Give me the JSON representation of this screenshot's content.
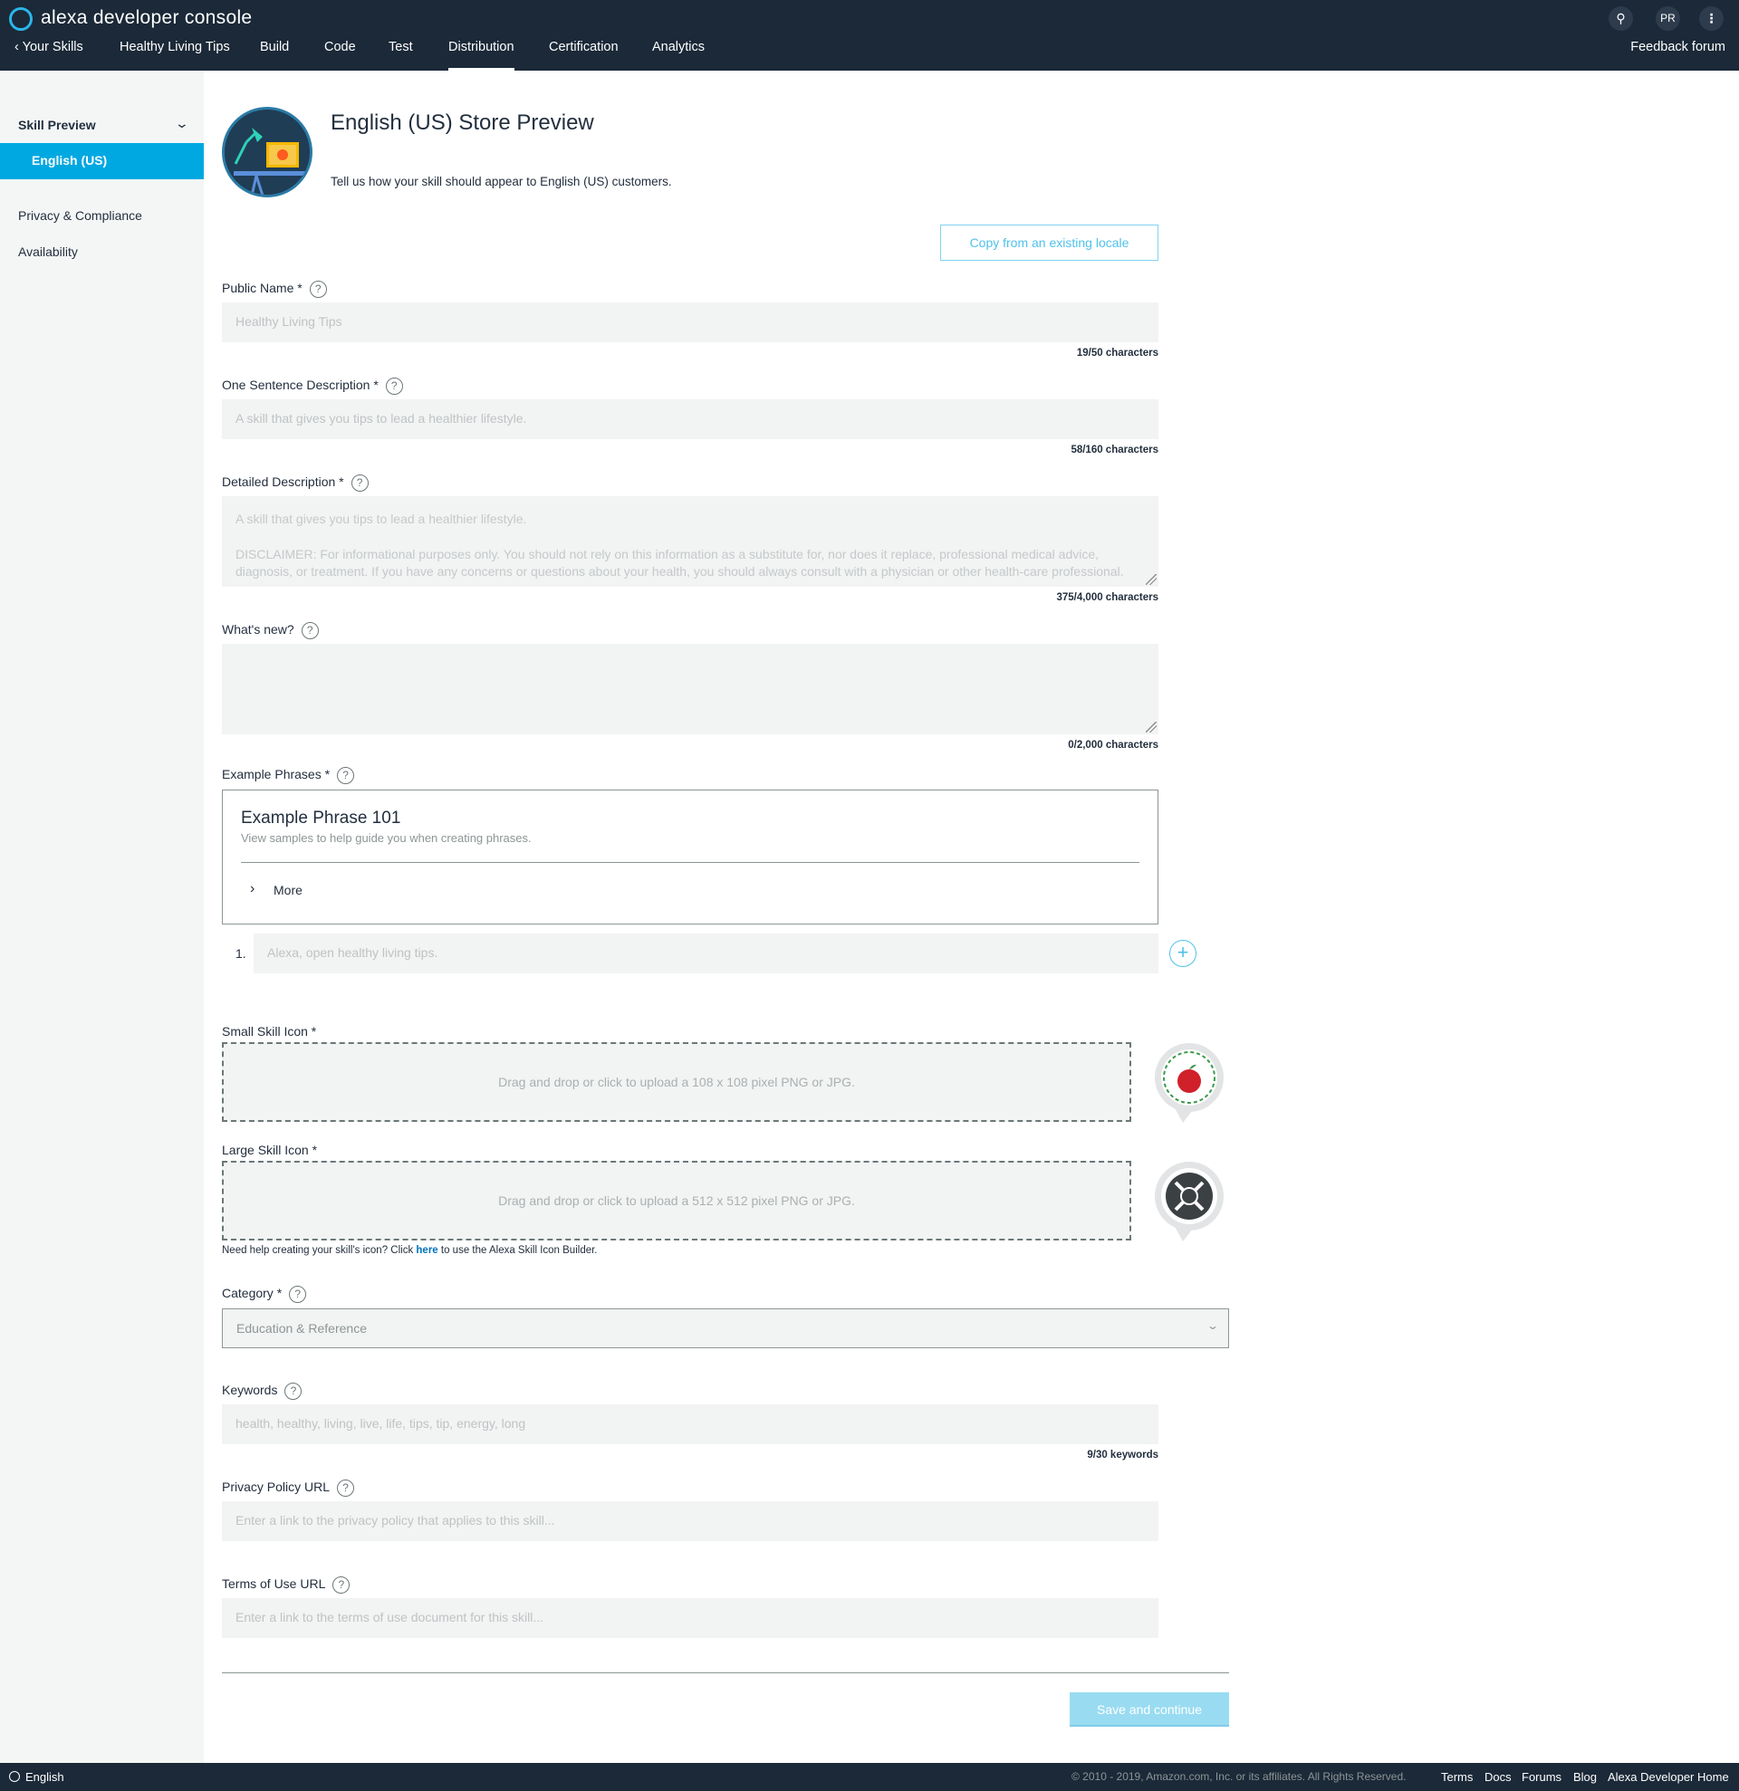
{
  "app": {
    "brand": "alexa developer console",
    "avatar_initials": "PR"
  },
  "nav": {
    "back_label": "Your Skills",
    "skill_name": "Healthy Living Tips",
    "tabs": [
      "Build",
      "Code",
      "Test",
      "Distribution",
      "Certification",
      "Analytics"
    ],
    "active_tab": "Distribution",
    "feedback": "Feedback forum"
  },
  "sidebar": {
    "group": "Skill Preview",
    "active_item": "English (US)",
    "items": [
      "Privacy & Compliance",
      "Availability"
    ]
  },
  "header": {
    "title": "English (US) Store Preview",
    "subtitle": "Tell us how your skill should appear to English (US) customers.",
    "copy_button": "Copy from an existing locale"
  },
  "fields": {
    "public_name": {
      "label": "Public Name *",
      "value": "Healthy Living Tips",
      "counter": "19/50 characters"
    },
    "one_sentence": {
      "label": "One Sentence Description *",
      "value": "A skill that gives you tips to lead a healthier lifestyle.",
      "counter": "58/160 characters"
    },
    "detailed": {
      "label": "Detailed Description *",
      "line1": "A skill that gives you tips to lead a healthier lifestyle.",
      "line2": "DISCLAIMER: For informational purposes only. You should not rely on this information as a substitute for, nor does it replace, professional medical advice,",
      "line3": "diagnosis, or treatment. If you have any concerns or questions about your health, you should always consult with a physician or other health-care professional.",
      "counter": "375/4,000 characters"
    },
    "whats_new": {
      "label": "What's new?",
      "counter": "0/2,000 characters"
    },
    "example_phrases": {
      "label": "Example Phrases *",
      "box_title": "Example Phrase 101",
      "box_sub": "View samples to help guide you when creating phrases.",
      "more": "More",
      "num": "1.",
      "phrase": "Alexa, open healthy living tips."
    },
    "small_icon": {
      "label": "Small Skill Icon *",
      "drop": "Drag and drop or click to upload a 108 x 108 pixel PNG or JPG."
    },
    "large_icon": {
      "label": "Large Skill Icon *",
      "drop": "Drag and drop or click to upload a 512 x 512 pixel PNG or JPG."
    },
    "icon_help": {
      "prefix": "Need help creating your skill's icon? Click ",
      "link": "here",
      "suffix": " to use the Alexa Skill Icon Builder."
    },
    "category": {
      "label": "Category *",
      "value": "Education & Reference"
    },
    "keywords": {
      "label": "Keywords",
      "value": "health, healthy, living, live, life, tips, tip, energy, long",
      "counter": "9/30 keywords"
    },
    "privacy_url": {
      "label": "Privacy Policy URL",
      "placeholder": "Enter a link to the privacy policy that applies to this skill..."
    },
    "terms_url": {
      "label": "Terms of Use URL",
      "placeholder": "Enter a link to the terms of use document for this skill..."
    }
  },
  "actions": {
    "save": "Save and continue"
  },
  "footer": {
    "language": "English",
    "copyright": "© 2010 - 2019, Amazon.com, Inc. or its affiliates. All Rights Reserved.",
    "links": [
      "Terms",
      "Docs",
      "Forums",
      "Blog",
      "Alexa Developer Home"
    ]
  },
  "colors": {
    "topbar": "#1b2938",
    "accent": "#00a8e1",
    "save_disabled": "#99dcf2"
  }
}
